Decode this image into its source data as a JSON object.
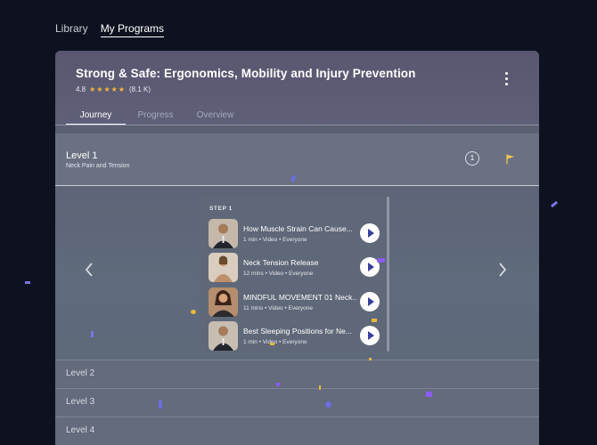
{
  "topnav": {
    "library": "Library",
    "my_programs": "My Programs"
  },
  "program": {
    "title": "Strong & Safe: Ergonomics, Mobility and Injury Prevention",
    "rating": "4.8",
    "stars": "★★★★★",
    "rating_count": "(8.1 K)",
    "tabs": [
      "Journey",
      "Progress",
      "Overview"
    ],
    "active_tab": "Journey"
  },
  "level1": {
    "title": "Level 1",
    "subtitle": "Neck Pain and Tension",
    "badge": "1"
  },
  "step": {
    "label": "STEP 1",
    "items": [
      {
        "name": "How Muscle Strain Can Cause...",
        "meta": "1 min • Video • Everyone"
      },
      {
        "name": "Neck Tension Release",
        "meta": "12 mins • Video • Everyone"
      },
      {
        "name": "MINDFUL MOVEMENT 01 Neck...",
        "meta": "11 mins • Video • Everyone"
      },
      {
        "name": "Best Sleeping Positions for Ne...",
        "meta": "1 min • Video • Everyone"
      }
    ]
  },
  "levels": [
    "Level 2",
    "Level 3",
    "Level 4"
  ],
  "colors": {
    "background": "#0e1220",
    "star": "#f4b63b",
    "accent_flag": "#f2c94c",
    "play_icon": "#3a3f9a"
  }
}
